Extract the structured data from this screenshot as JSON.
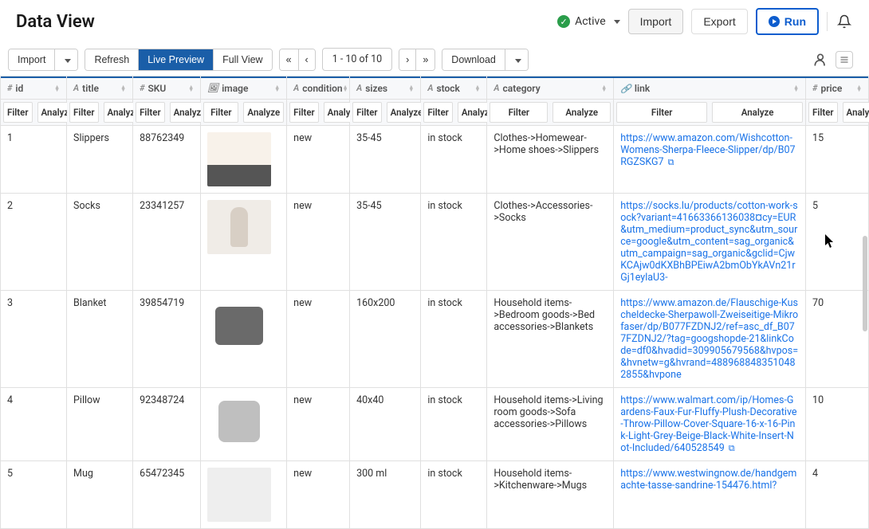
{
  "page": {
    "title": "Data View"
  },
  "header": {
    "status": "Active",
    "import": "Import",
    "export": "Export",
    "run": "Run"
  },
  "toolbar": {
    "import": "Import",
    "refresh": "Refresh",
    "live_preview": "Live Preview",
    "full_view": "Full View",
    "pager": {
      "first": "«",
      "prev": "‹",
      "info": "1 - 10 of 10",
      "next": "›",
      "last": "»"
    },
    "download": "Download"
  },
  "columns": {
    "id": {
      "label": "id",
      "type": "#",
      "filter": "Filter",
      "analyze": "Analyze"
    },
    "title": {
      "label": "title",
      "type": "A",
      "filter": "Filter",
      "analyze": "Analyze"
    },
    "sku": {
      "label": "SKU",
      "type": "#",
      "filter": "Filter",
      "analyze": "Analyze"
    },
    "image": {
      "label": "image",
      "type": "img",
      "filter": "Filter",
      "analyze": "Analyze"
    },
    "condition": {
      "label": "condition",
      "type": "A",
      "filter": "Filter",
      "analyze": "Analyze"
    },
    "sizes": {
      "label": "sizes",
      "type": "A",
      "filter": "Filter",
      "analyze": "Analyze"
    },
    "stock": {
      "label": "stock",
      "type": "A",
      "filter": "Filter",
      "analyze": "Analyze"
    },
    "category": {
      "label": "category",
      "type": "A",
      "filter": "Filter",
      "analyze": "Analyze"
    },
    "link": {
      "label": "link",
      "type": "link",
      "filter": "Filter",
      "analyze": "Analyze"
    },
    "price": {
      "label": "price",
      "type": "#",
      "filter": "Filter",
      "analyze": "Analyze"
    }
  },
  "rows": [
    {
      "id": "1",
      "title": "Slippers",
      "sku": "88762349",
      "condition": "new",
      "sizes": "35-45",
      "stock": "in stock",
      "category": "Clothes->Homewear->Home shoes->Slippers",
      "link": "https://www.amazon.com/Wishcotton-Womens-Sherpa-Fleece-Slipper/dp/B07RGZSKG7",
      "price": "15",
      "img_class": "img-slippers"
    },
    {
      "id": "2",
      "title": "Socks",
      "sku": "23341257",
      "condition": "new",
      "sizes": "35-45",
      "stock": "in stock",
      "category": "Clothes->Accessories->Socks",
      "link": "https://socks.lu/products/cotton-work-sock?variant=41663366136038&currency=EUR&utm_medium=product_sync&utm_source=google&utm_content=sag_organic&utm_campaign=sag_organic&gclid=CjwKCAjw0dKXBhBPEiwA2bmObYkAVn21rGj1eylaU3-",
      "price": "5",
      "img_class": "img-socks"
    },
    {
      "id": "3",
      "title": "Blanket",
      "sku": "39854719",
      "condition": "new",
      "sizes": "160x200",
      "stock": "in stock",
      "category": "Household items->Bedroom goods->Bed accessories->Blankets",
      "link": "https://www.amazon.de/Flauschige-Kuscheldecke-Sherpawoll-Zweiseitige-Mikrofaser/dp/B077FZDNJ2/ref=asc_df_B077FZDNJ2/?tag=googshopde-21&linkCode=df0&hvadid=309905679568&hvpos=&hvnetw=g&hvrand=4889688483510482855&hvpone",
      "price": "70",
      "img_class": "img-blanket"
    },
    {
      "id": "4",
      "title": "Pillow",
      "sku": "92348724",
      "condition": "new",
      "sizes": "40x40",
      "stock": "in stock",
      "category": "Household items->Living room goods->Sofa accessories->Pillows",
      "link": "https://www.walmart.com/ip/Homes-Gardens-Faux-Fur-Fluffy-Plush-Decorative-Throw-Pillow-Cover-Square-16-x-16-Pink-Light-Grey-Beige-Black-White-Insert-Not-Included/640528549",
      "price": "10",
      "img_class": "img-pillow"
    },
    {
      "id": "5",
      "title": "Mug",
      "sku": "65472345",
      "condition": "new",
      "sizes": "300 ml",
      "stock": "in stock",
      "category": "Household items->Kitchenware->Mugs",
      "link": "https://www.westwingnow.de/handgemachte-tasse-sandrine-154476.html?",
      "price": "4",
      "img_class": ""
    }
  ]
}
